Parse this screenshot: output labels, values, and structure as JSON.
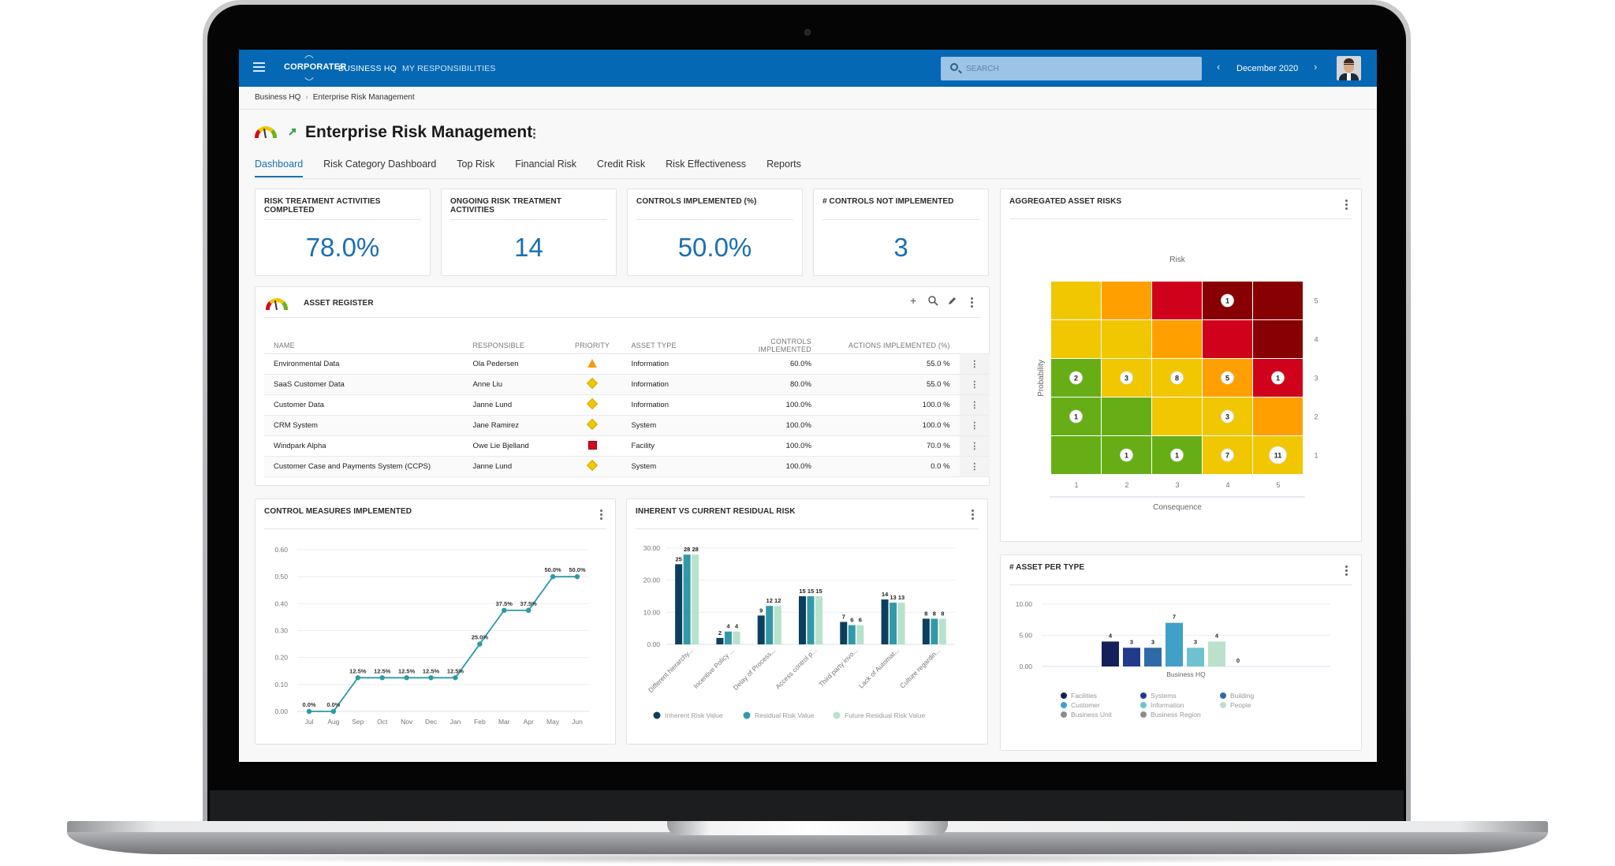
{
  "topbar": {
    "brand": "CORPORATER",
    "nav": [
      "BUSINESS HQ",
      "MY RESPONSIBILITIES"
    ],
    "search_placeholder": "SEARCH",
    "period": "December 2020"
  },
  "breadcrumb": [
    "Business HQ",
    "Enterprise Risk Management"
  ],
  "page": {
    "title": "Enterprise Risk Management",
    "tabs": [
      "Dashboard",
      "Risk Category Dashboard",
      "Top Risk",
      "Financial Risk",
      "Credit Risk",
      "Risk Effectiveness",
      "Reports"
    ],
    "active_tab": "Dashboard"
  },
  "kpis": [
    {
      "title": "RISK TREATMENT ACTIVITIES COMPLETED",
      "value": "78.0%"
    },
    {
      "title": "ONGOING RISK TREATMENT ACTIVITIES",
      "value": "14"
    },
    {
      "title": "CONTROLS IMPLEMENTED (%)",
      "value": "50.0%"
    },
    {
      "title": "# CONTROLS NOT IMPLEMENTED",
      "value": "3"
    }
  ],
  "asset_register": {
    "title": "ASSET REGISTER",
    "columns": [
      "NAME",
      "RESPONSIBLE",
      "PRIORITY",
      "ASSET TYPE",
      "CONTROLS IMPLEMENTED",
      "ACTIONS IMPLEMENTED (%)"
    ],
    "rows": [
      {
        "name": "Environmental Data",
        "responsible": "Ola Pedersen",
        "priority": "medium-high",
        "priority_color": "#f39c12",
        "asset_type": "Information",
        "controls": "60.0%",
        "actions": "55.0 %"
      },
      {
        "name": "SaaS Customer Data",
        "responsible": "Anne Liu",
        "priority": "medium",
        "priority_color": "#f0c700",
        "asset_type": "Information",
        "controls": "80.0%",
        "actions": "55.0 %"
      },
      {
        "name": "Customer Data",
        "responsible": "Janne Lund",
        "priority": "medium",
        "priority_color": "#f0c700",
        "asset_type": "Information",
        "controls": "100.0%",
        "actions": "100.0 %"
      },
      {
        "name": "CRM System",
        "responsible": "Jane Ramirez",
        "priority": "medium",
        "priority_color": "#f0c700",
        "asset_type": "System",
        "controls": "100.0%",
        "actions": "100.0 %"
      },
      {
        "name": "Windpark Alpha",
        "responsible": "Owe Lie Bjelland",
        "priority": "high",
        "priority_color": "#d50b1c",
        "asset_type": "Facility",
        "controls": "100.0%",
        "actions": "70.0 %"
      },
      {
        "name": "Customer Case and Payments System (CCPS)",
        "responsible": "Janne Lund",
        "priority": "medium",
        "priority_color": "#f0c700",
        "asset_type": "System",
        "controls": "100.0%",
        "actions": "0.0 %"
      }
    ]
  },
  "chart_data": [
    {
      "id": "aggregated-asset-risks",
      "type": "heatmap",
      "title": "AGGREGATED ASSET RISKS",
      "subtitle": "Risk",
      "xlabel": "Consequence",
      "ylabel": "Probability",
      "x_ticks": [
        "1",
        "2",
        "3",
        "4",
        "5"
      ],
      "y_ticks": [
        "1",
        "2",
        "3",
        "4",
        "5"
      ],
      "cell_colors": {
        "5": [
          "#f0c700",
          "#ffa000",
          "#d0021b",
          "#870004",
          "#870004"
        ],
        "4": [
          "#f0c700",
          "#f0c700",
          "#ffa000",
          "#d0021b",
          "#870004"
        ],
        "3": [
          "#67ae16",
          "#f0c700",
          "#f0c700",
          "#ffa000",
          "#d0021b"
        ],
        "2": [
          "#67ae16",
          "#67ae16",
          "#f0c700",
          "#f0c700",
          "#ffa000"
        ],
        "1": [
          "#67ae16",
          "#67ae16",
          "#67ae16",
          "#f0c700",
          "#f0c700"
        ]
      },
      "counts": [
        {
          "consequence": 4,
          "probability": 5,
          "count": 1
        },
        {
          "consequence": 1,
          "probability": 3,
          "count": 2
        },
        {
          "consequence": 2,
          "probability": 3,
          "count": 3
        },
        {
          "consequence": 3,
          "probability": 3,
          "count": 8
        },
        {
          "consequence": 4,
          "probability": 3,
          "count": 5
        },
        {
          "consequence": 5,
          "probability": 3,
          "count": 1
        },
        {
          "consequence": 1,
          "probability": 2,
          "count": 1
        },
        {
          "consequence": 4,
          "probability": 2,
          "count": 3
        },
        {
          "consequence": 2,
          "probability": 1,
          "count": 1
        },
        {
          "consequence": 3,
          "probability": 1,
          "count": 1
        },
        {
          "consequence": 4,
          "probability": 1,
          "count": 7
        },
        {
          "consequence": 5,
          "probability": 1,
          "count": 11
        }
      ]
    },
    {
      "id": "control-measures-implemented",
      "type": "line",
      "title": "CONTROL MEASURES IMPLEMENTED",
      "x": [
        "Jul",
        "Aug",
        "Sep",
        "Oct",
        "Nov",
        "Dec",
        "Jan",
        "Feb",
        "Mar",
        "Apr",
        "May",
        "Jun"
      ],
      "values": [
        0,
        0,
        0.125,
        0.125,
        0.125,
        0.125,
        0.125,
        0.25,
        0.375,
        0.375,
        0.5,
        0.5
      ],
      "labels": [
        "0.0%",
        "0.0%",
        "12.5%",
        "12.5%",
        "12.5%",
        "12.5%",
        "12.5%",
        "25.0%",
        "37.5%",
        "37.5%",
        "50.0%",
        "50.0%"
      ],
      "y_ticks": [
        "0.00",
        "0.10",
        "0.20",
        "0.30",
        "0.40",
        "0.50",
        "0.60"
      ],
      "ylim": [
        0,
        0.6
      ],
      "color": "#2a9aa8",
      "grid": true
    },
    {
      "id": "inherent-vs-residual",
      "type": "bar",
      "title": "INHERENT VS CURRENT RESIDUAL RISK",
      "categories": [
        "Different hierarchy...",
        "Incentive Policy ...",
        "Delay of Process...",
        "Access control p...",
        "Third party invo...",
        "Lack of Automat...",
        "Culture regardin..."
      ],
      "series": [
        {
          "name": "Inherent Risk Value",
          "color": "#0c3f5f",
          "values": [
            25,
            2,
            9,
            15,
            7,
            14,
            8
          ]
        },
        {
          "name": "Residual Risk Value",
          "color": "#3399a8",
          "values": [
            28,
            4,
            12,
            15,
            6,
            13,
            8
          ]
        },
        {
          "name": "Future Residual Risk Value",
          "color": "#b7e2cc",
          "values": [
            28,
            4,
            12,
            15,
            6,
            13,
            8
          ]
        }
      ],
      "y_ticks": [
        "0.00",
        "10.00",
        "20.00",
        "30.00"
      ],
      "ylim": [
        0,
        30
      ],
      "legend": "bottom",
      "grid": true
    },
    {
      "id": "asset-per-type",
      "type": "bar",
      "title": "# ASSET PER TYPE",
      "categories": [
        "Business HQ"
      ],
      "series": [
        {
          "name": "Facilities",
          "color": "#14205a",
          "values": [
            4
          ]
        },
        {
          "name": "Systems",
          "color": "#233a8c",
          "values": [
            3
          ]
        },
        {
          "name": "Building",
          "color": "#2f6aa8",
          "values": [
            3
          ]
        },
        {
          "name": "Customer",
          "color": "#40a0c8",
          "values": [
            7
          ]
        },
        {
          "name": "Information",
          "color": "#6ec2d0",
          "values": [
            3
          ]
        },
        {
          "name": "People",
          "color": "#bce0cb",
          "values": [
            4
          ]
        },
        {
          "name": "Business Unit",
          "color": "#8c8c8c",
          "values": [
            0
          ]
        },
        {
          "name": "Business Region",
          "color": "#8c8c8c",
          "values": [
            null
          ]
        }
      ],
      "y_ticks": [
        "0.00",
        "5.00",
        "10.00"
      ],
      "ylim": [
        0,
        10
      ],
      "legend": "bottom",
      "grid": true
    }
  ]
}
